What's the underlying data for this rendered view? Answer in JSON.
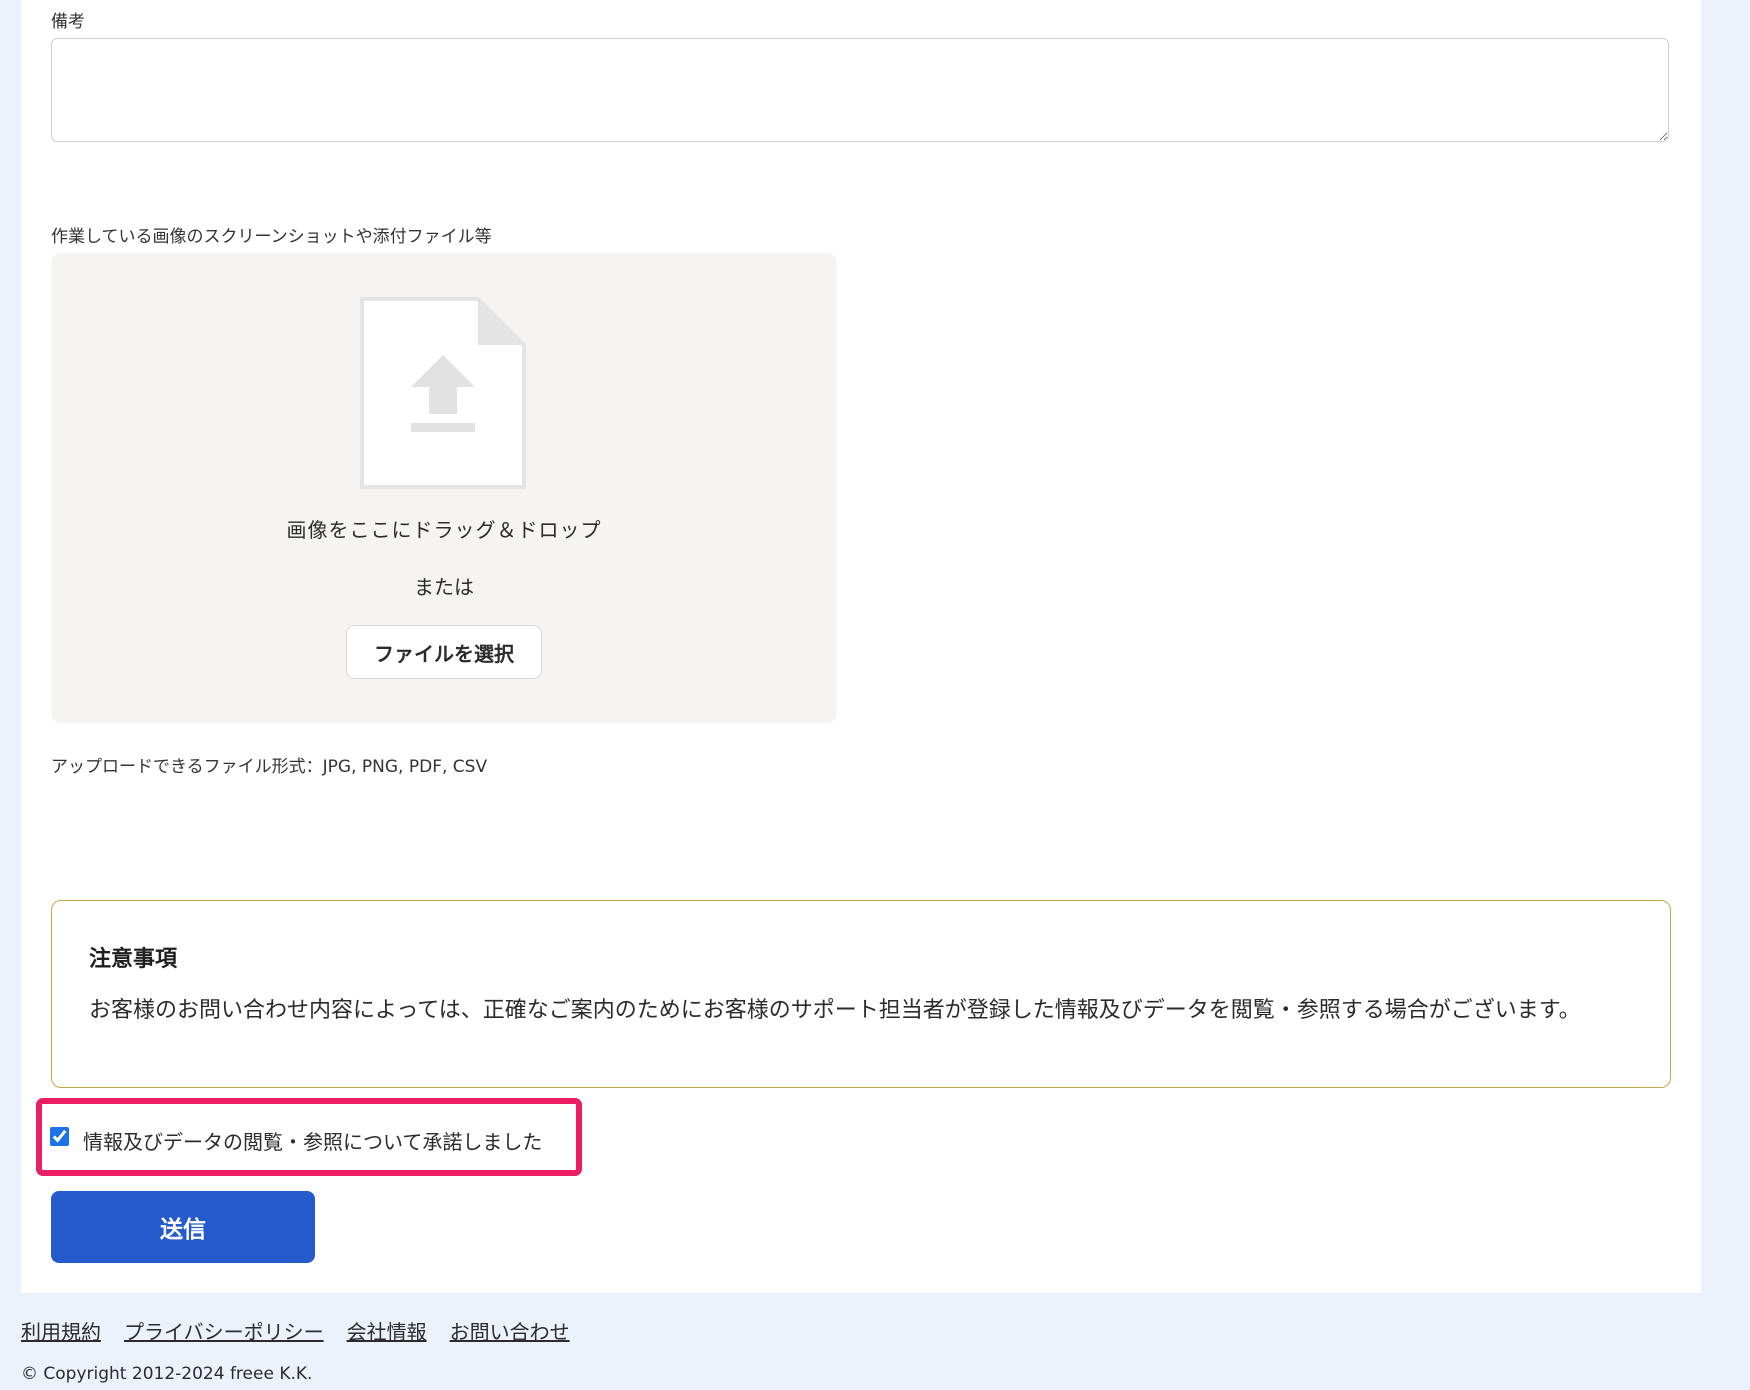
{
  "form": {
    "memo_label": "備考",
    "memo_value": "",
    "attachment_label": "作業している画像のスクリーンショットや添付ファイル等",
    "dropzone": {
      "icon": "file-upload-icon",
      "drop_text": "画像をここにドラッグ＆ドロップ",
      "or_text": "または",
      "select_button_label": "ファイルを選択"
    },
    "formats_note": "アップロードできるファイル形式：JPG, PNG, PDF, CSV"
  },
  "notice": {
    "title": "注意事項",
    "body": "お客様のお問い合わせ内容によっては、正確なご案内のためにお客様のサポート担当者が登録した情報及びデータを閲覧・参照する場合がございます。"
  },
  "consent": {
    "label": "情報及びデータの閲覧・参照について承諾しました",
    "checked": true,
    "highlight_color": "#ea1f63"
  },
  "submit": {
    "label": "送信",
    "color": "#255acc"
  },
  "footer": {
    "links": [
      "利用規約",
      "プライバシーポリシー",
      "会社情報",
      "お問い合わせ"
    ],
    "copyright": "© Copyright 2012-2024 freee K.K."
  },
  "colors": {
    "page_background": "#ebf2fc",
    "panel_background": "#ffffff",
    "dropzone_background": "#f5f4f2",
    "notice_border": "#c9a647"
  }
}
